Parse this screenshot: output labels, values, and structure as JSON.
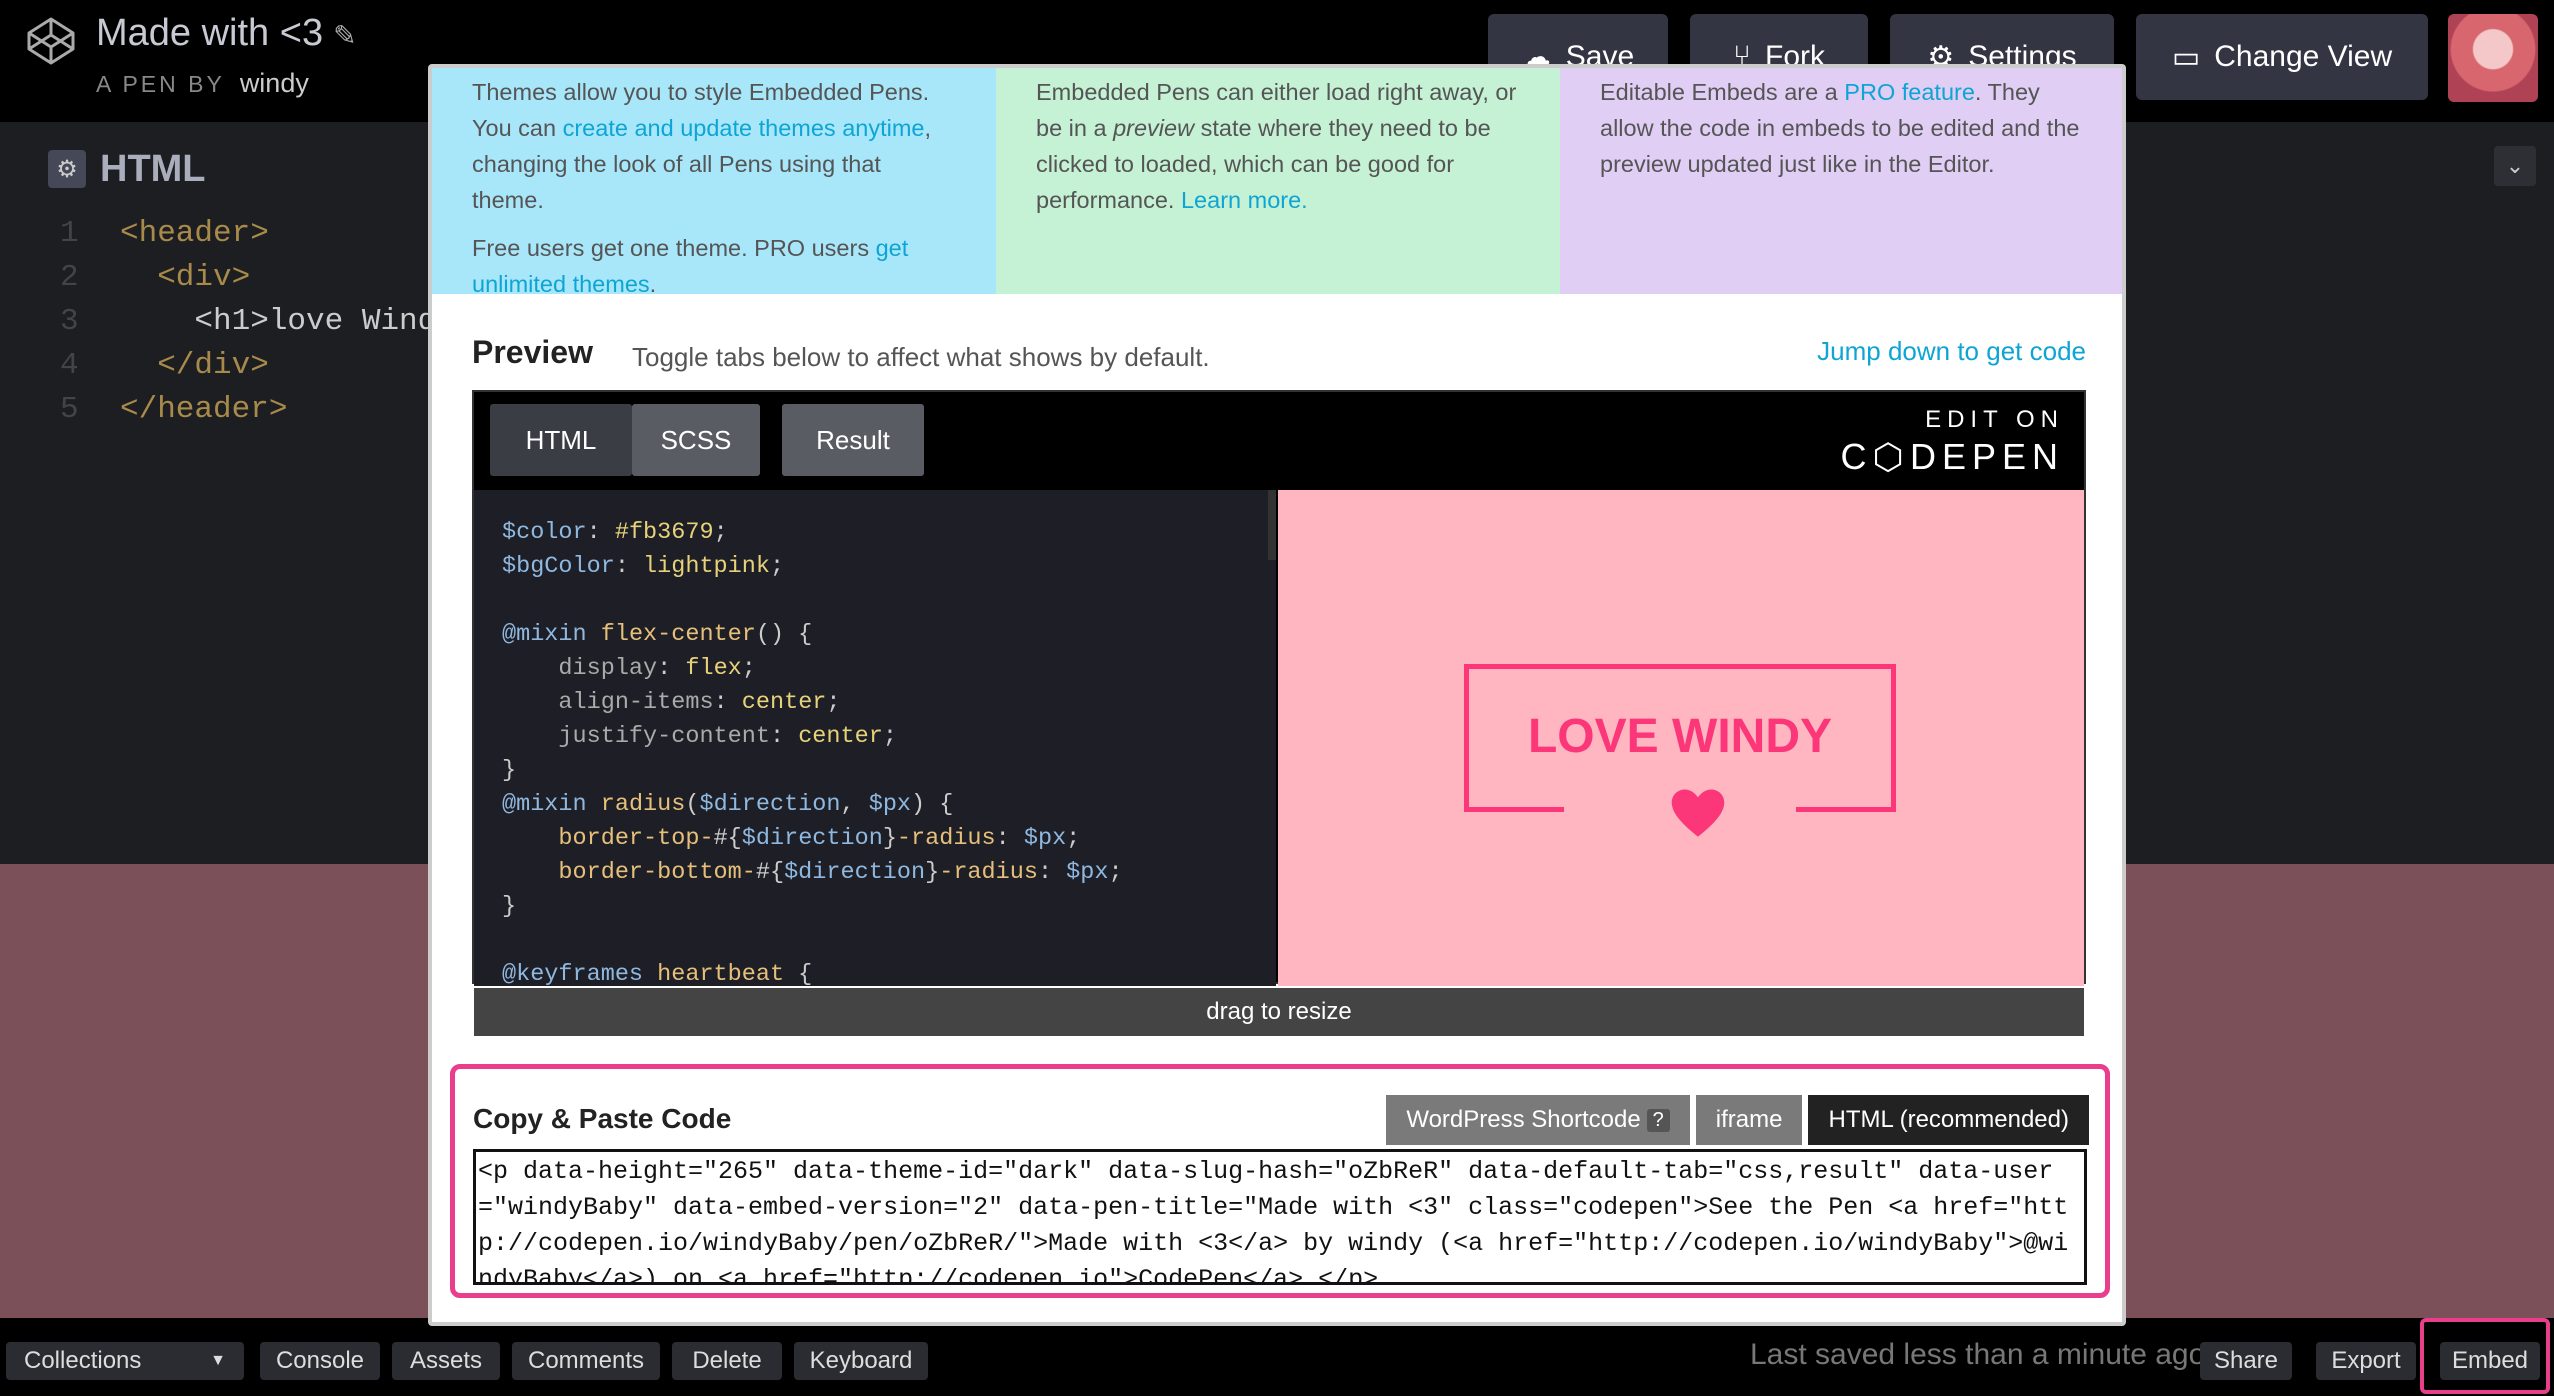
{
  "header": {
    "title": "Made with <3",
    "byline_prefix": "A PEN BY",
    "author": "windy",
    "buttons": {
      "save": "Save",
      "fork": "Fork",
      "settings": "Settings",
      "change_view": "Change View"
    }
  },
  "editor": {
    "panel_label": "HTML",
    "lines": [
      {
        "num": "1",
        "code": "<header>"
      },
      {
        "num": "2",
        "code": "  <div>"
      },
      {
        "num": "3",
        "code": "    <h1>love Wind"
      },
      {
        "num": "4",
        "code": "  </div>"
      },
      {
        "num": "5",
        "code": "</header>"
      }
    ]
  },
  "modal": {
    "info": {
      "themes_p1_a": "Themes allow you to style Embedded Pens. You can ",
      "themes_link": "create and update themes anytime",
      "themes_p1_b": ", changing the look of all Pens using that theme.",
      "themes_p2_a": "Free users get one theme. PRO users ",
      "themes_p2_link": "get unlimited themes",
      "themes_p2_b": ".",
      "load_a": "Embedded Pens can either load right away, or be in a ",
      "load_em": "preview",
      "load_b": " state where they need to be clicked to loaded, which can be good for performance. ",
      "load_link": "Learn more.",
      "edit_a": "Editable Embeds are a ",
      "edit_link": "PRO feature",
      "edit_b": ". They allow the code in embeds to be edited and the preview updated just like in the Editor."
    },
    "preview": {
      "title": "Preview",
      "subtitle": "Toggle tabs below to affect what shows by default.",
      "jump_link": "Jump down to get code",
      "tabs": {
        "html": "HTML",
        "scss": "SCSS",
        "result": "Result"
      },
      "edit_on": "EDIT ON",
      "codepen": "C⬡DEPEN",
      "result_text": "LOVE WINDY",
      "drag": "drag to resize"
    },
    "copy": {
      "title": "Copy & Paste Code",
      "tabs": {
        "wordpress": "WordPress Shortcode",
        "help": "?",
        "iframe": "iframe",
        "html": "HTML (recommended)"
      },
      "code": "<p data-height=\"265\" data-theme-id=\"dark\" data-slug-hash=\"oZbReR\" data-default-tab=\"css,result\" data-user=\"windyBaby\" data-embed-version=\"2\" data-pen-title=\"Made with <3\" class=\"codepen\">See the Pen <a href=\"http://codepen.io/windyBaby/pen/oZbReR/\">Made with <3</a> by windy (<a href=\"http://codepen.io/windyBaby\">@windyBaby</a>) on <a href=\"http://codepen.io\">CodePen</a>.</p>"
    }
  },
  "footer": {
    "collections": "Collections",
    "console": "Console",
    "assets": "Assets",
    "comments": "Comments",
    "delete": "Delete",
    "keyboard": "Keyboard",
    "saved": "Last saved less than a minute ago",
    "share": "Share",
    "export": "Export",
    "embed": "Embed"
  },
  "colors": {
    "accent": "#e83e8c",
    "link": "#0ea5d4",
    "result_color": "#fb3679",
    "result_bg": "#ffb6c1"
  }
}
